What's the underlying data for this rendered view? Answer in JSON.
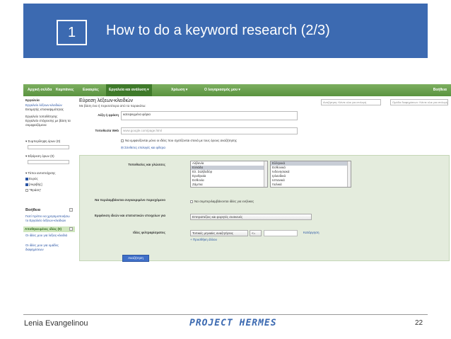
{
  "slide": {
    "number": "1",
    "title": "How to do a keyword research (2/3)",
    "author": "Lenia Evangelinou",
    "logo": "PROJECT HERMES",
    "page": "22",
    "header_color": "#3c6ab1"
  },
  "nav": {
    "items": [
      "Αρχική σελίδα",
      "Καμπάνιες",
      "Ευκαιρίες",
      "Εργαλεία και ανάλυση ▾",
      "Χρέωση ▾",
      "Ο λογαριασμός μου ▾"
    ],
    "help": "Βοήθεια",
    "accent_color": "#5a9340"
  },
  "sidebar": {
    "tools_heading": "Εργαλεία",
    "tools_links": [
      "Εργαλείο λέξεων-κλειδιών",
      "Εκτιμητής επισκεψιμότητας",
      "Εργαλείο τοποθέτησης",
      "Εργαλείο στόχευσης με βάση τα συμφραζόμενα"
    ],
    "match_filter": "▾ Συμπερίληψη όρων (0)",
    "exclude_filter": "▾ Εξαίρεση όρων (0)",
    "match_types_heading": "▾ Τύποι αντιστοίχισης",
    "match_types": [
      {
        "label": "Ευρύς",
        "checked": true
      },
      {
        "label": "[Ακριβής]",
        "checked": true
      },
      {
        "label": "\"Φράση\"",
        "checked": false
      }
    ],
    "help_heading": "Βοήθεια",
    "help_link": "Γιατί πρέπει να χρησιμοποιήσω το Εργαλείο λέξεων-κλειδιών",
    "saved_heading": "Αποθηκευμένες ιδέες (0)",
    "saved_links": [
      "Οι ιδέες μου για λέξεις-κλειδιά",
      "Οι ιδέες μου για ομάδες διαφημίσεων"
    ]
  },
  "main": {
    "title": "Εύρεση λέξεων-κλειδιών",
    "subtitle": "Με βάση ένα ή περισσότερα από τα παρακάτω:",
    "word_label": "Λέξη ή φράση",
    "word_value": "κατεψυγμένα φάρια",
    "website_label": "Τοποθεσία Web",
    "website_placeholder": "www.google.com/page.html",
    "only_ideas": "Να εμφανίζονται μόνο οι ιδέες που σχετίζονται στενά με τους όρους αναζήτησης",
    "advanced_link": "⊟ Σύνθετες επιλογές και φίλτρα",
    "locations_label": "Τοποθεσίες και γλώσσες",
    "countries": [
      "Αλβανία",
      "Ελλάδα",
      "Ελ. Σαλβαδόρ",
      "Ερυθραία",
      "Εσθονία",
      "Ζάμπια"
    ],
    "languages": [
      "Ελληνικά",
      "Εσθονικά",
      "Ινδονησιακά",
      "Ιρλανδικά",
      "Ισπανικά",
      "Ιταλικά"
    ],
    "adult_label": "Να περιλαμβάνεται συγκεκριμένο περιεχόμενο",
    "adult_option": "Να συμπεριλαμβάνονται ιδέες για ενήλικες",
    "stats_label": "Εμφάνιση ιδεών και στατιστικών στοιχείων για",
    "stats_value": "Επιτραπέζιες και φορητές συσκευές",
    "filter_label": "Ιδέες φιλτραρίσματος",
    "filter_field": "Τοπικές μηνιαίες αναζητήσεις",
    "filter_op": "<=",
    "filter_apply": "Κατάργηση",
    "add_another": "+ Προσθήκη άλλου",
    "search_button": "Αναζήτηση",
    "search_box1": "Αναζήτηση: Κάντε κλικ για επιλογή",
    "search_box2": "Ομάδα διαφημίσεων: Κάντε κλικ για επιλογή"
  }
}
